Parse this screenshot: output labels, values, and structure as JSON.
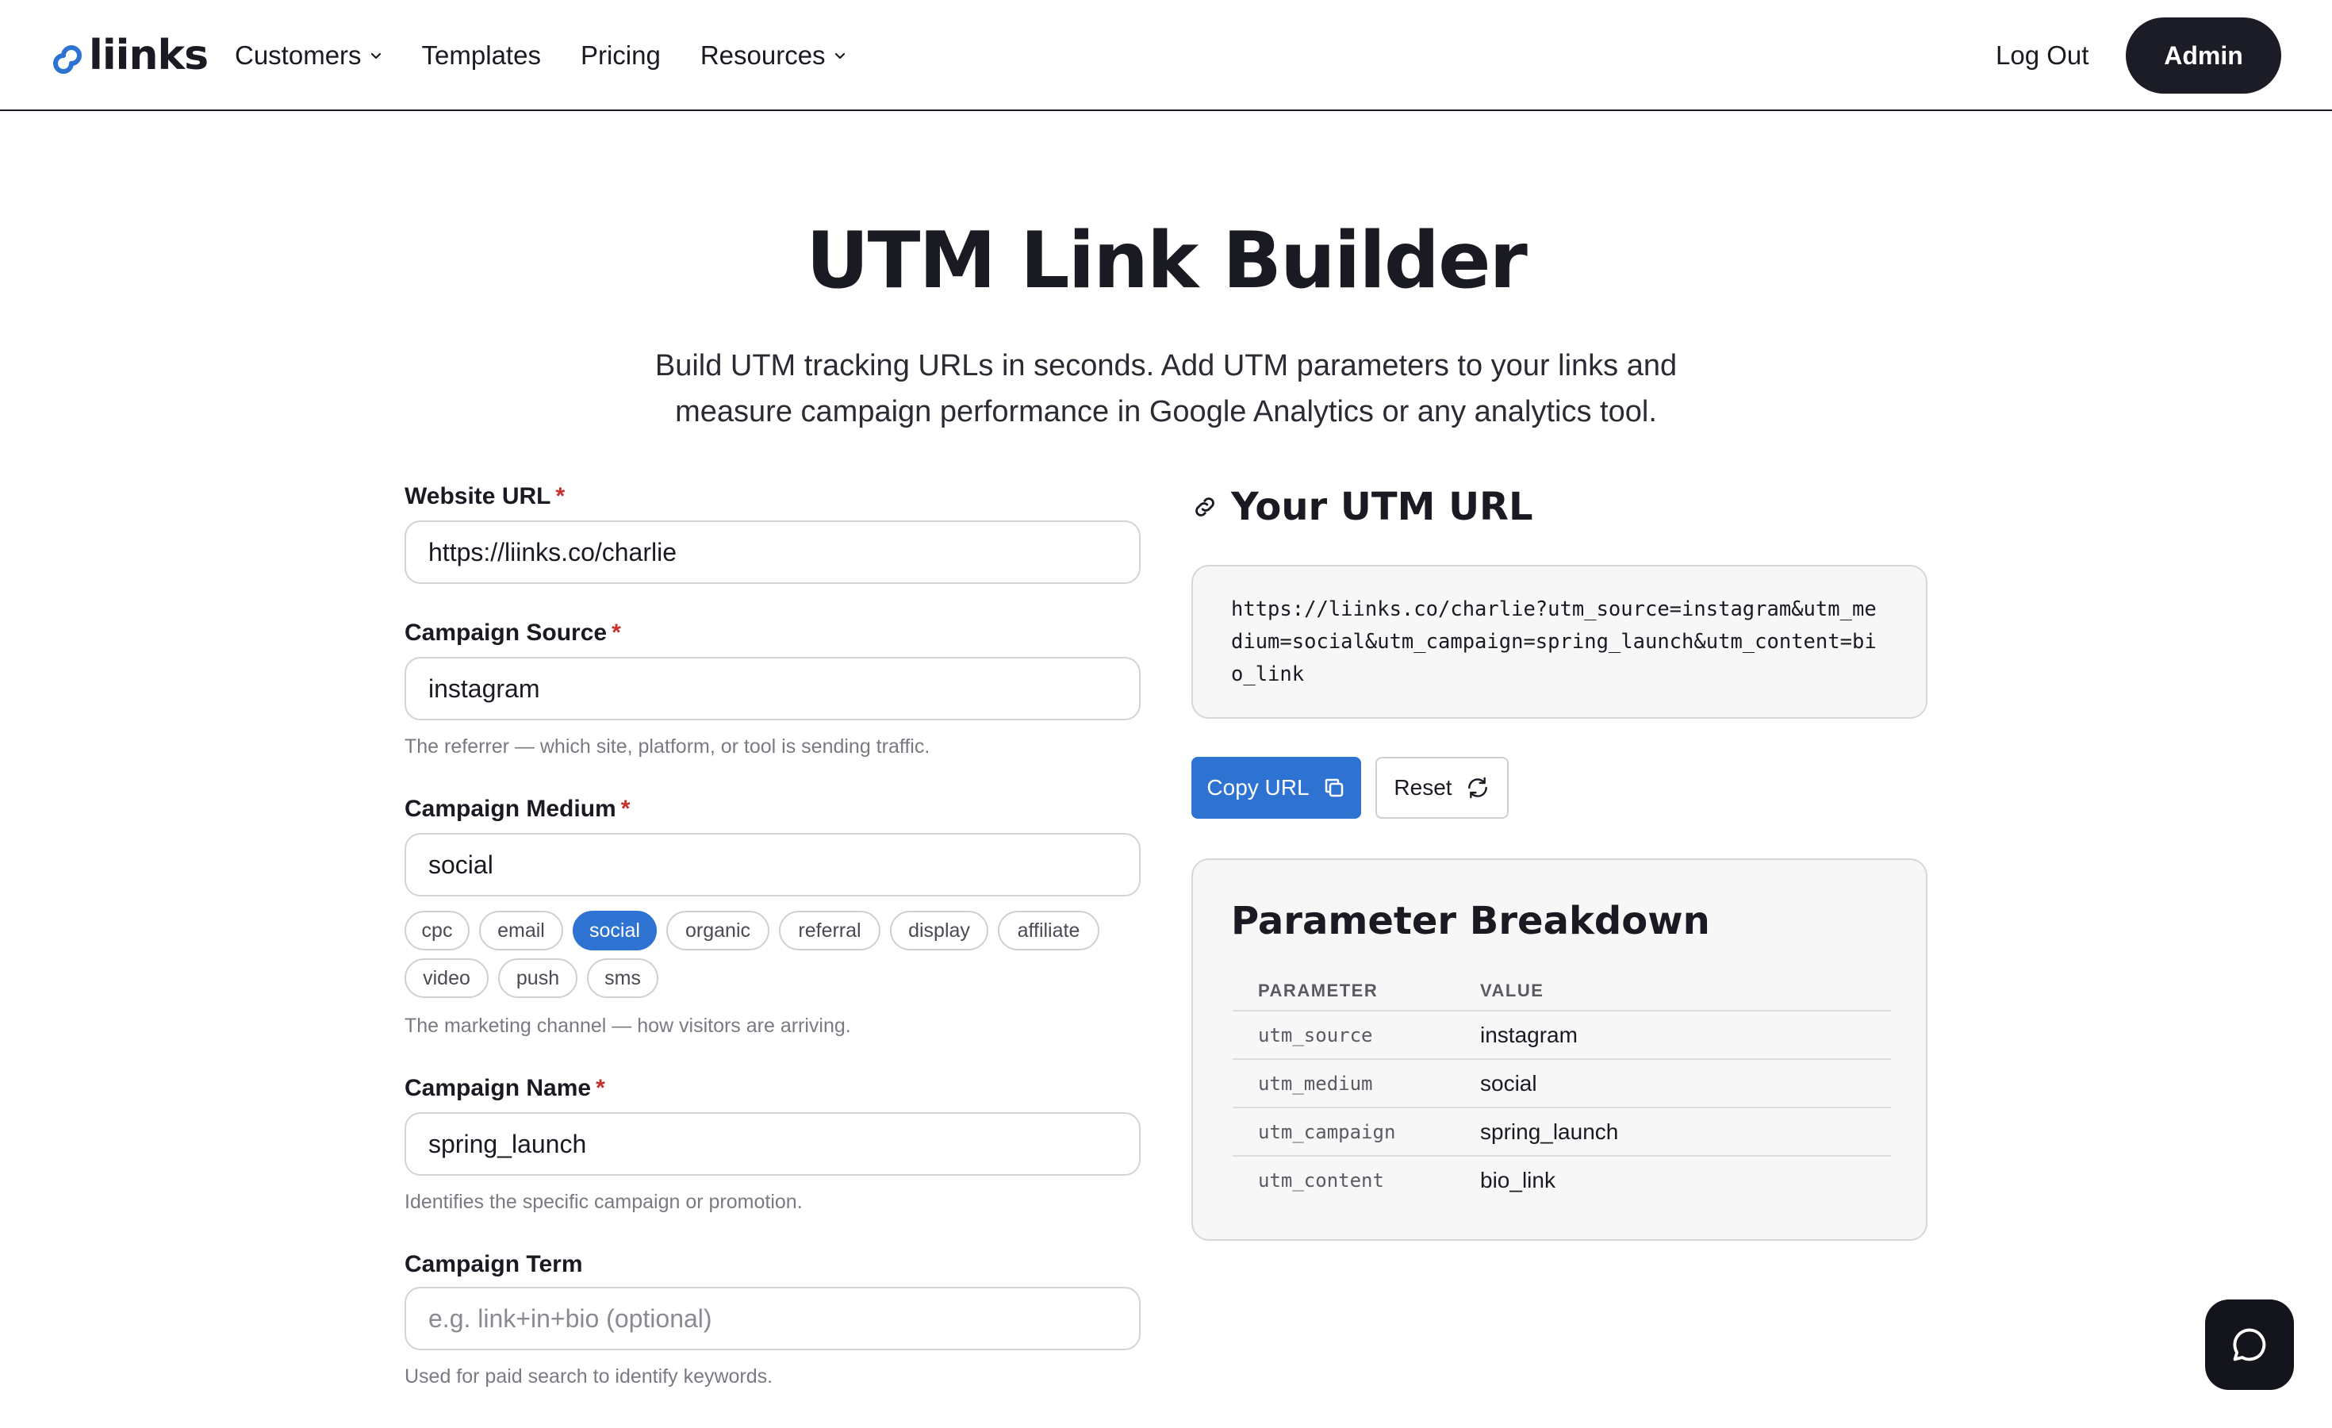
{
  "header": {
    "logo_text": "liinks",
    "nav": [
      {
        "label": "Customers",
        "has_dropdown": true
      },
      {
        "label": "Templates",
        "has_dropdown": false
      },
      {
        "label": "Pricing",
        "has_dropdown": false
      },
      {
        "label": "Resources",
        "has_dropdown": true
      }
    ],
    "logout_label": "Log Out",
    "admin_label": "Admin"
  },
  "hero": {
    "title_highlight": "UTM",
    "title_rest": " Link Builder",
    "subtitle_line1": "Build UTM tracking URLs in seconds. Add UTM parameters to your links and",
    "subtitle_line2": "measure campaign performance in Google Analytics or any analytics tool.",
    "highlight_color": "#cda6ef"
  },
  "form": {
    "required_mark": "*",
    "website_url": {
      "label": "Website URL",
      "value": "https://liinks.co/charlie",
      "required": true
    },
    "campaign_source": {
      "label": "Campaign Source",
      "value": "instagram",
      "required": true,
      "hint": "The referrer — which site, platform, or tool is sending traffic."
    },
    "campaign_medium": {
      "label": "Campaign Medium",
      "value": "social",
      "required": true,
      "hint": "The marketing channel — how visitors are arriving.",
      "chips": [
        "cpc",
        "email",
        "social",
        "organic",
        "referral",
        "display",
        "affiliate",
        "video",
        "push",
        "sms"
      ],
      "active_chip": "social"
    },
    "campaign_name": {
      "label": "Campaign Name",
      "value": "spring_launch",
      "required": true,
      "hint": "Identifies the specific campaign or promotion."
    },
    "campaign_term": {
      "label": "Campaign Term",
      "value": "",
      "placeholder": "e.g. link+in+bio (optional)",
      "required": false,
      "hint": "Used for paid search to identify keywords."
    }
  },
  "result": {
    "heading": "Your UTM URL",
    "url": "https://liinks.co/charlie?utm_source=instagram&utm_medium=social&utm_campaign=spring_launch&utm_content=bio_link",
    "copy_label": "Copy URL",
    "reset_label": "Reset",
    "accent_color": "#2f73d2"
  },
  "breakdown": {
    "title": "Parameter Breakdown",
    "columns": [
      "PARAMETER",
      "VALUE"
    ],
    "rows": [
      {
        "param": "utm_source",
        "value": "instagram"
      },
      {
        "param": "utm_medium",
        "value": "social"
      },
      {
        "param": "utm_campaign",
        "value": "spring_launch"
      },
      {
        "param": "utm_content",
        "value": "bio_link"
      }
    ]
  },
  "icons": {
    "logo": "link-logo-icon",
    "chevron": "chevron-down-icon",
    "link": "link-icon",
    "copy": "copy-icon",
    "reset": "refresh-icon",
    "chat": "chat-bubble-icon"
  }
}
